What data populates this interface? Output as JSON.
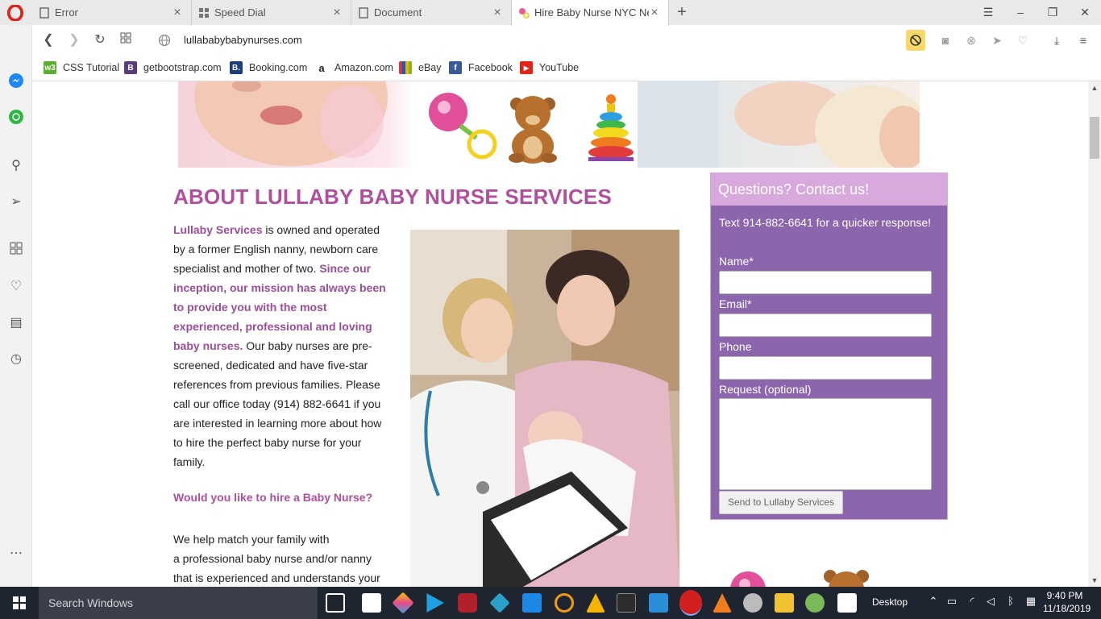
{
  "browser": {
    "tabs": [
      {
        "title": "Error"
      },
      {
        "title": "Speed Dial"
      },
      {
        "title": "Document"
      },
      {
        "title": "Hire Baby Nurse NYC New"
      }
    ],
    "url": "lullababybabynurses.com",
    "bookmarks": [
      {
        "label": "CSS Tutorial"
      },
      {
        "label": "getbootstrap.com"
      },
      {
        "label": "Booking.com"
      },
      {
        "label": "Amazon.com"
      },
      {
        "label": "eBay"
      },
      {
        "label": "Facebook"
      },
      {
        "label": "YouTube"
      }
    ]
  },
  "page": {
    "title": "ABOUT LULLABY BABY NURSE SERVICES",
    "intro_brand": "Lullaby Services",
    "intro_1": " is owned and operated by a former English nanny, newborn care specialist and mother of two. ",
    "mission": "Since our inception, our mission has always been to provide you with the most experienced, professional and loving baby nurses.",
    "intro_2": " Our baby nurses are pre-screened, dedicated and have five-star references from previous families. Please call our office today (914) 882-6641 if you are interested in learning more about how to hire the perfect baby nurse for your family.",
    "hire_heading": "Would you like to hire a Baby Nurse?",
    "help_line_1": "We help match your family with",
    "help_line_2": "a professional baby nurse and/or nanny",
    "help_line_3": "that is experienced and understands your"
  },
  "contact": {
    "heading": "Questions? Contact us!",
    "subtext": "Text 914-882-6641 for a quicker response!",
    "name_label": "Name*",
    "email_label": "Email*",
    "phone_label": "Phone",
    "request_label": "Request (optional)",
    "submit_label": "Send to Lullaby Services"
  },
  "taskbar": {
    "search_placeholder": "Search Windows",
    "desktop_label": "Desktop",
    "time": "9:40 PM",
    "date": "11/18/2019"
  },
  "colors": {
    "accent": "#b14e9d",
    "panel": "#8c66ad",
    "panel_header": "#d7a9dc"
  }
}
